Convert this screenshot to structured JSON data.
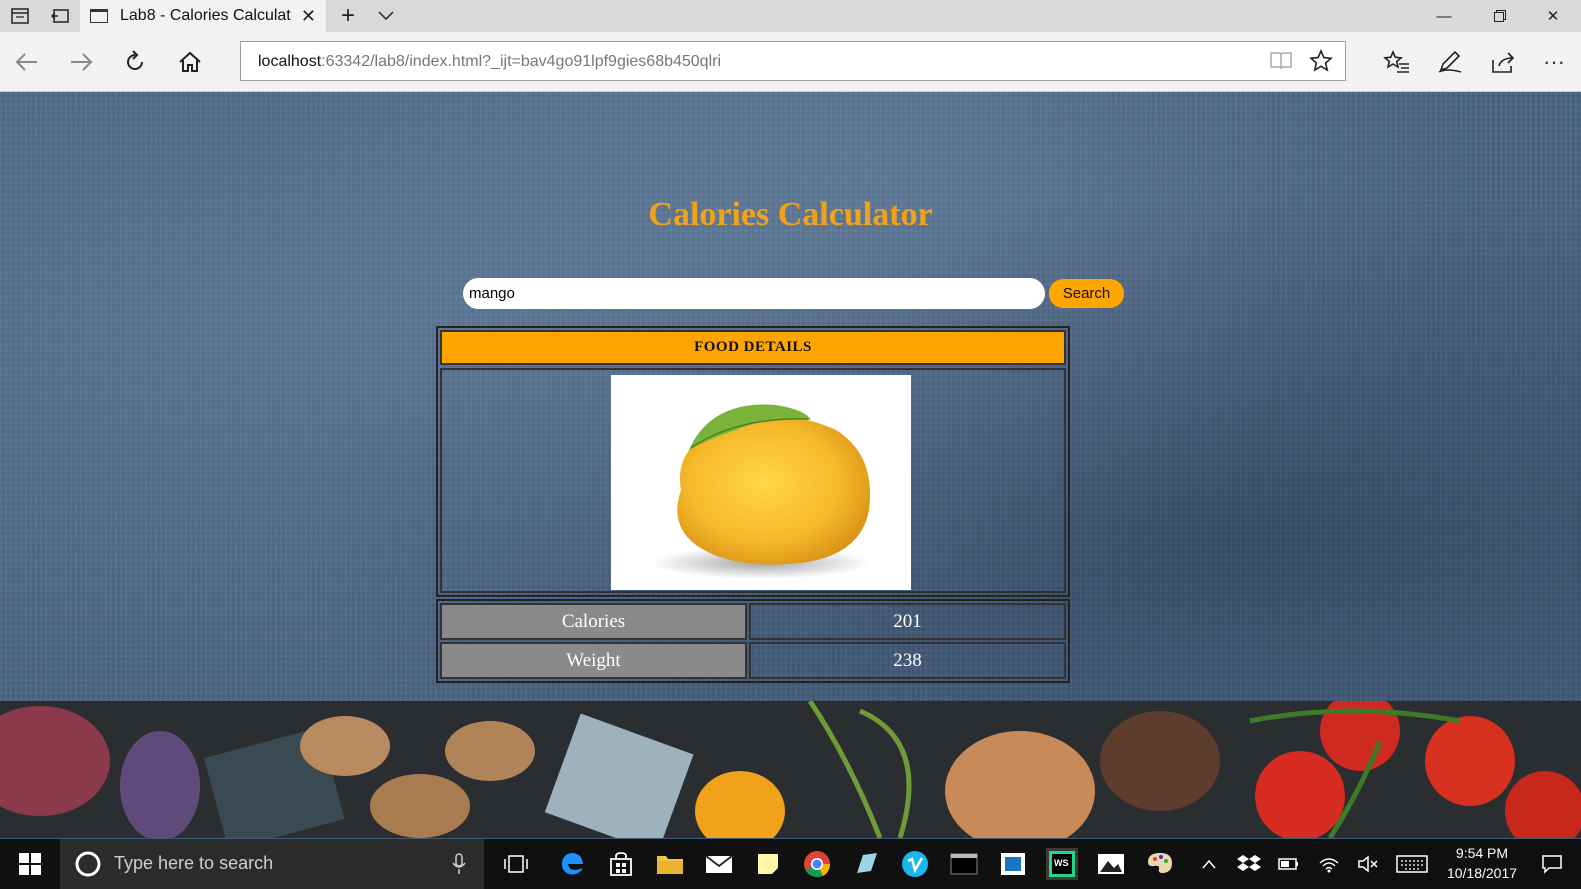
{
  "browser": {
    "tab_title": "Lab8 - Calories Calculat",
    "url_host": "localhost",
    "url_rest": ":63342/lab8/index.html?_ijt=bav4go91lpf9gies68b450qlri"
  },
  "page": {
    "heading": "Calories Calculator",
    "search": {
      "value": "mango",
      "button_label": "Search"
    },
    "details_header": "FOOD DETAILS",
    "food_image_icon": "mango-image",
    "nutrition": [
      {
        "label": "Calories",
        "value": "201"
      },
      {
        "label": "Weight",
        "value": "238"
      }
    ]
  },
  "taskbar": {
    "search_placeholder": "Type here to search",
    "time": "9:54 PM",
    "date": "10/18/2017"
  },
  "colors": {
    "accent_orange": "#ffa500",
    "heading_orange": "#f2a21a"
  }
}
